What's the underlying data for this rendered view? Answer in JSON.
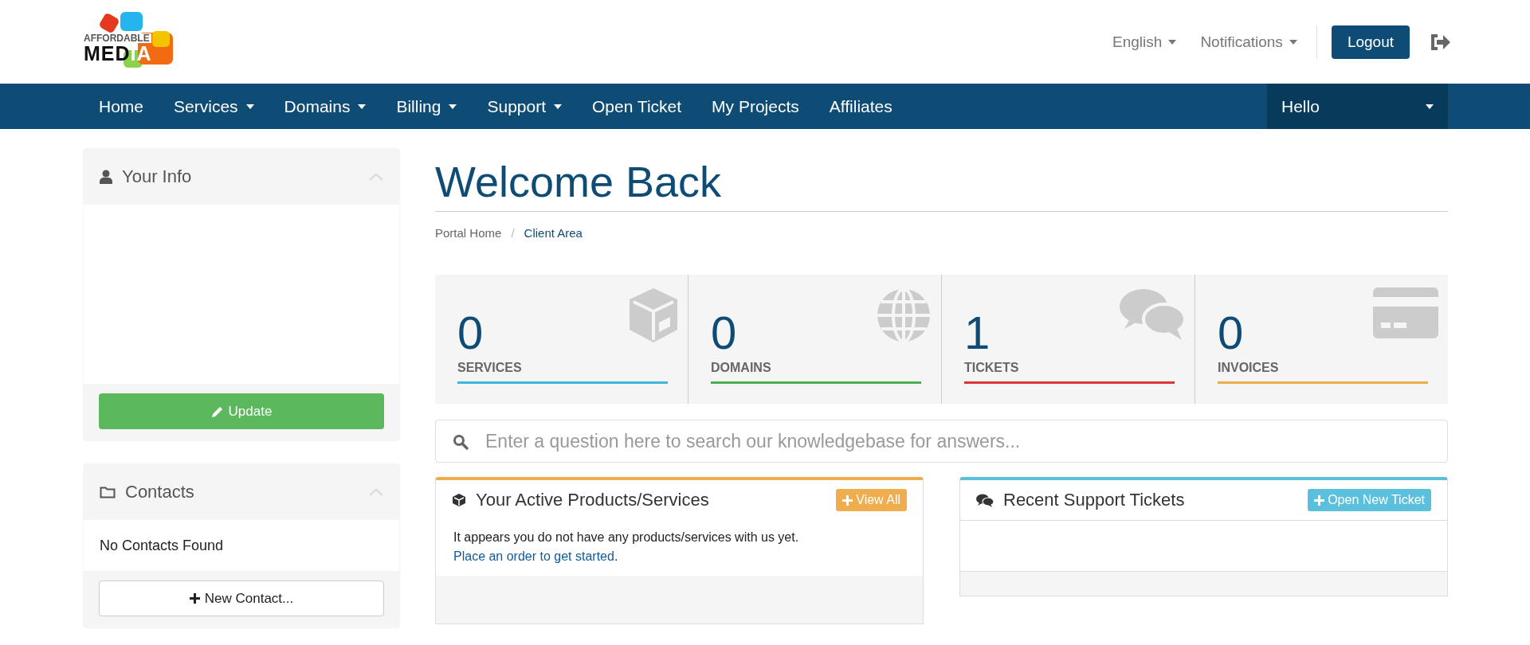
{
  "logo": {
    "top_text": "AFFORDABLE",
    "main_text": "MED",
    "accent_text": "IA"
  },
  "top_links": [
    {
      "label": "English",
      "dropdown": true
    },
    {
      "label": "Notifications",
      "dropdown": true
    }
  ],
  "logout_button": "Logout",
  "nav": [
    {
      "label": "Home",
      "dropdown": false
    },
    {
      "label": "Services",
      "dropdown": true
    },
    {
      "label": "Domains",
      "dropdown": true
    },
    {
      "label": "Billing",
      "dropdown": true
    },
    {
      "label": "Support",
      "dropdown": true
    },
    {
      "label": "Open Ticket",
      "dropdown": false
    },
    {
      "label": "My Projects",
      "dropdown": false
    },
    {
      "label": "Affiliates",
      "dropdown": false
    }
  ],
  "account_menu": {
    "label": "Hello",
    "dropdown": true
  },
  "sidebar": [
    {
      "kind": "info",
      "title": "Your Info",
      "expanded": true,
      "button": {
        "label": "Update",
        "kind": "success"
      }
    },
    {
      "kind": "contacts",
      "title": "Contacts",
      "expanded": true,
      "body": "No Contacts Found",
      "button": {
        "label": "New Contact...",
        "kind": "default"
      }
    }
  ],
  "page_title": "Welcome Back",
  "breadcrumb_separator": "/",
  "breadcrumb": [
    {
      "label": "Portal Home",
      "selected": false
    },
    {
      "label": "Client Area",
      "selected": true
    }
  ],
  "stats": [
    {
      "kind": "box",
      "value": "0",
      "label": "SERVICES",
      "color": "#3fb5e0"
    },
    {
      "kind": "globe",
      "value": "0",
      "label": "DOMAINS",
      "color": "#4cae4c"
    },
    {
      "kind": "chat",
      "value": "1",
      "label": "TICKETS",
      "color": "#dd3535"
    },
    {
      "kind": "card",
      "value": "0",
      "label": "INVOICES",
      "color": "#f0ad4e"
    }
  ],
  "search": {
    "placeholder": "Enter a question here to search our knowledgebase for answers..."
  },
  "panels": [
    {
      "kind": "products",
      "title": "Your Active Products/Services",
      "color": "#f0ad4e",
      "button": "View All",
      "message": "It appears you do not have any products/services with us yet.",
      "link": "Place an order to get started",
      "after_link": "."
    },
    {
      "kind": "tickets",
      "title": "Recent Support Tickets",
      "color": "#5bc0de",
      "button": "Open New Ticket"
    }
  ]
}
